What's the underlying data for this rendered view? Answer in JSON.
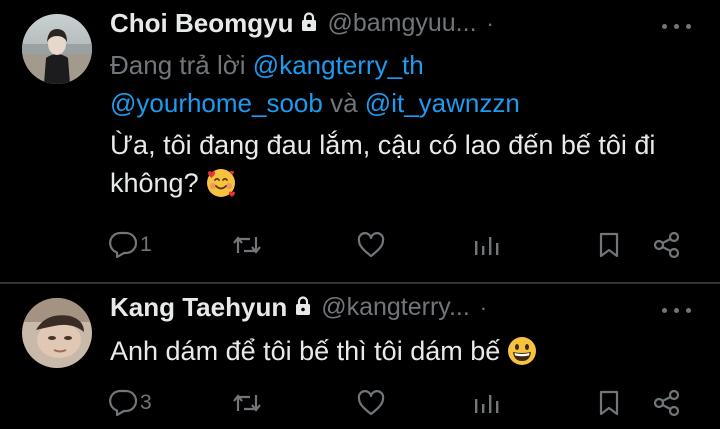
{
  "tweets": [
    {
      "display_name": "Choi Beomgyu",
      "handle": "@bamgyuu...",
      "time_dot": "·",
      "replying_to_prefix": "Đang trả lời",
      "mention_1": "@kangterry_th",
      "mention_2": "@yourhome_soob",
      "conjunction": "và",
      "mention_3": "@it_yawnzzn",
      "text": "Ừa, tôi đang đau lắm, cậu có lao đến bế tôi đi không?",
      "emoji_icon": "smiling-face-with-hearts-icon",
      "reply_count": "1",
      "retweet_count": "",
      "like_count": "",
      "view_count": ""
    },
    {
      "display_name": "Kang Taehyun",
      "handle": "@kangterry...",
      "time_dot": "·",
      "text": "Anh dám để tôi bế thì tôi dám bế",
      "emoji_icon": "grinning-face-icon",
      "reply_count": "3",
      "retweet_count": "",
      "like_count": "",
      "view_count": ""
    }
  ],
  "colors": {
    "background": "#000000",
    "primary_text": "#e7e9ea",
    "secondary_text": "#71767b",
    "link": "#1d9bf0",
    "divider": "#2f3336"
  }
}
